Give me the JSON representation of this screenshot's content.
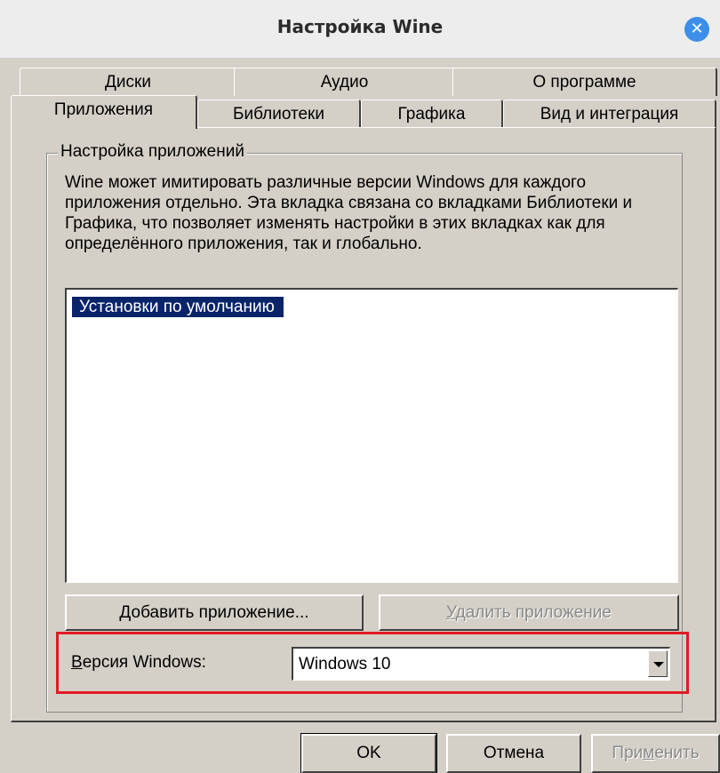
{
  "window": {
    "title": "Настройка Wine",
    "close_icon": "close-icon"
  },
  "tabs_back": [
    "Диски",
    "Аудио",
    "О программе"
  ],
  "tabs_front": [
    "Приложения",
    "Библиотеки",
    "Графика",
    "Вид и интеграция"
  ],
  "group": {
    "legend": "Настройка приложений",
    "description": "Wine может имитировать различные версии Windows для каждого приложения отдельно. Эта вкладка связана со вкладками Библиотеки и Графика, что позволяет изменять настройки в этих вкладках как для определённого приложения, так и глобально.",
    "list_items": [
      "Установки по умолчанию"
    ],
    "add_button_prefix": "",
    "add_button_mnemonic": "Д",
    "add_button_rest": "обавить приложение...",
    "remove_button_mnemonic": "У",
    "remove_button_rest": "далить приложение"
  },
  "windows_version": {
    "label_mnemonic": "В",
    "label_rest": "ерсия Windows:",
    "selected": "Windows 10"
  },
  "footer": {
    "ok": "OK",
    "cancel": "Отмена",
    "apply_pre": "При",
    "apply_mnemonic": "м",
    "apply_rest": "енить"
  },
  "colors": {
    "highlight": "#e01b24",
    "selection": "#0a246a",
    "close": "#3d8ee8"
  }
}
